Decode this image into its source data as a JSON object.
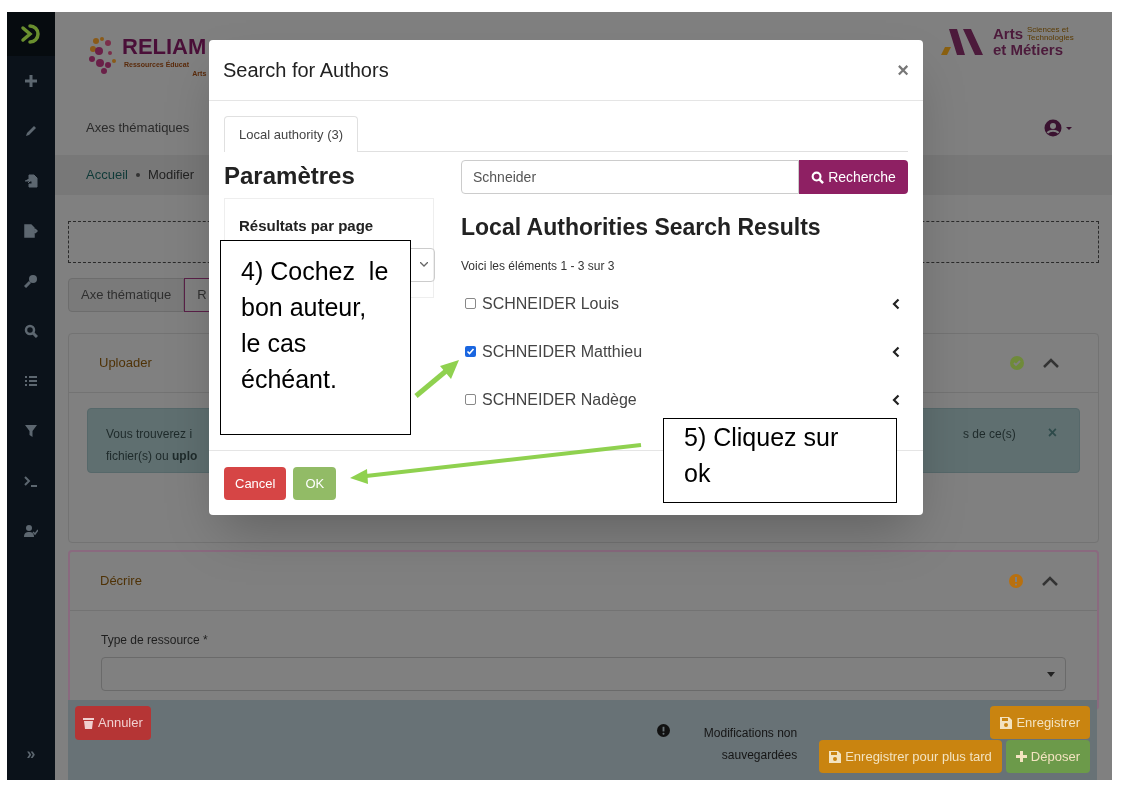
{
  "sidebar": {
    "collapse_glyph": "»"
  },
  "header": {
    "logo": {
      "title": "RELIAM",
      "subtitle_lines": [
        "Ressources Éducat",
        "Arts"
      ]
    },
    "partner_logo": {
      "line_1": "Arts",
      "tagline": "Sciences et Technologies",
      "line_2": "et Métiers"
    }
  },
  "nav": {
    "items": [
      {
        "label": "Axes thématiques"
      }
    ]
  },
  "breadcrumb": [
    {
      "label": "Accueil",
      "link": true
    },
    {
      "label": "Modifier",
      "link": false
    }
  ],
  "tabs": [
    {
      "label": "Axe thématique",
      "selected": false
    },
    {
      "label": "R",
      "selected": true
    }
  ],
  "sections": [
    {
      "title": "Uploader",
      "complete": true,
      "expanded": true,
      "alert": {
        "text_left": [
          "Vous trouverez i",
          "fichier(s) ou **uplo**"
        ],
        "text_right": "s de ce(s)",
        "close": "×"
      }
    },
    {
      "title": "Décrire",
      "complete": false,
      "expanded": true,
      "fields": [
        {
          "label": "Type de ressource *"
        }
      ]
    }
  ],
  "footer": {
    "cancel": "Annuler",
    "notice": "Modifications non sauvegardées",
    "save": "Enregistrer",
    "save_later": "Enregistrer pour plus tard",
    "submit": "Déposer"
  },
  "modal": {
    "title": "Search for Authors",
    "close": "×",
    "tabs": [
      {
        "label": "Local authority (3)",
        "selected": true
      }
    ],
    "parameters": {
      "title": "Paramètres",
      "results_per_page_label": "Résultats par page"
    },
    "search": {
      "value": "Schneider",
      "button": "Recherche"
    },
    "results_title": "Local Authorities Search Results",
    "summary": "Voici les éléments 1 - 3 sur 3",
    "results": [
      {
        "name": "SCHNEIDER Louis",
        "checked": false
      },
      {
        "name": "SCHNEIDER Matthieu",
        "checked": true
      },
      {
        "name": "SCHNEIDER Nadège",
        "checked": false
      }
    ],
    "buttons": {
      "cancel": "Cancel",
      "ok": "OK"
    }
  },
  "annotations": [
    {
      "text": "4) Cochez  le bon auteur, le cas échéant."
    },
    {
      "text": "5) Cliquez sur ok"
    }
  ]
}
